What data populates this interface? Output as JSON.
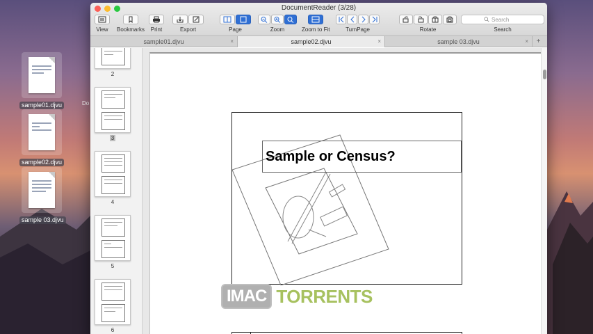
{
  "window": {
    "title": "DocumentReader (3/28)"
  },
  "toolbar": {
    "groups": [
      {
        "label": "View"
      },
      {
        "label": "Bookmarks"
      },
      {
        "label": "Print"
      },
      {
        "label": "Export"
      },
      {
        "label": "Page"
      },
      {
        "label": "Zoom"
      },
      {
        "label": "Zoom to Fit"
      },
      {
        "label": "TurnPage"
      },
      {
        "label": "Rotate"
      },
      {
        "label": "Search"
      }
    ],
    "search_placeholder": "Search"
  },
  "tabs": [
    {
      "label": "sample01.djvu",
      "close": "×"
    },
    {
      "label": "sample02.djvu",
      "close": "×"
    },
    {
      "label": "sample 03.djvu",
      "close": "×"
    }
  ],
  "tab_add": "+",
  "sidebar": {
    "thumbnails": [
      {
        "num": "2"
      },
      {
        "num": "3",
        "selected": true
      },
      {
        "num": "4"
      },
      {
        "num": "5"
      },
      {
        "num": "6"
      }
    ]
  },
  "document": {
    "slide_title": "Sample or Census?"
  },
  "desktop": {
    "icons": [
      {
        "label": "sample01.djvu"
      },
      {
        "label": "sample02.djvu"
      },
      {
        "label": "sample 03.djvu"
      }
    ],
    "partial_label": "Do"
  },
  "watermark": {
    "box": "IMAC",
    "text": "TORRENTS"
  },
  "colors": {
    "accent": "#2f6fd4",
    "watermark_green": "#a7c15f"
  }
}
